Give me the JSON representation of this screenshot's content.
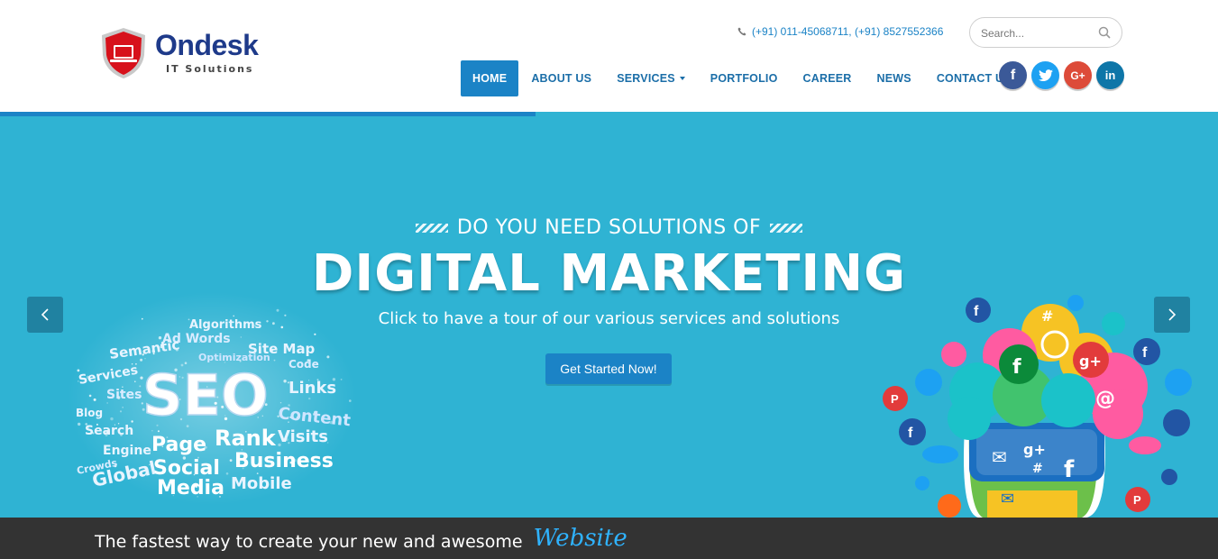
{
  "brand": {
    "name": "Ondesk",
    "tagline": "IT Solutions"
  },
  "header": {
    "phone": "(+91) 011-45068711, (+91) 8527552366",
    "search": {
      "placeholder": "Search..."
    }
  },
  "nav": {
    "items": [
      {
        "label": "HOME",
        "active": true
      },
      {
        "label": "ABOUT US"
      },
      {
        "label": "SERVICES",
        "dropdown": true
      },
      {
        "label": "PORTFOLIO"
      },
      {
        "label": "CAREER"
      },
      {
        "label": "NEWS"
      },
      {
        "label": "CONTACT US"
      }
    ]
  },
  "social": [
    {
      "name": "facebook-icon",
      "glyph": "f"
    },
    {
      "name": "twitter-icon",
      "glyph": "🐦"
    },
    {
      "name": "google-plus-icon",
      "glyph": "G+"
    },
    {
      "name": "linkedin-icon",
      "glyph": "in"
    }
  ],
  "hero": {
    "pretitle": "DO YOU NEED SOLUTIONS OF",
    "title": "DIGITAL MARKETING",
    "subtitle": "Click to have a tour of our various services and solutions",
    "cta": "Get Started Now!",
    "slide_progress": 0.44,
    "seo_cloud": {
      "main": "SEO",
      "words": [
        "Algorithms",
        "Ad Words",
        "Site Map",
        "Semantic",
        "Optimization",
        "Code",
        "Services",
        "Sites",
        "Links",
        "Blog",
        "Search",
        "Content",
        "Engine",
        "Page",
        "Rank",
        "Visits",
        "Crowds",
        "Global",
        "Social",
        "Business",
        "Media",
        "Mobile"
      ]
    }
  },
  "footer_bar": {
    "tagline": "The fastest way to create your new and awesome",
    "accent": "Website"
  },
  "colors": {
    "brand_blue": "#1b83c6",
    "hero_bg": "#2fb3d3",
    "nav_text": "#1b6ea8",
    "bottom_bar": "#333333"
  }
}
